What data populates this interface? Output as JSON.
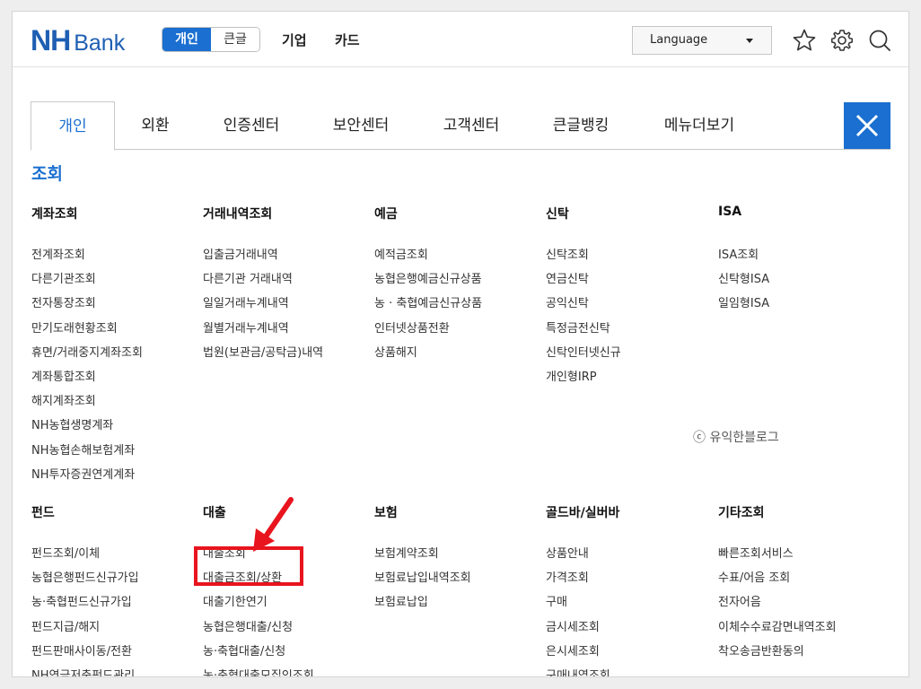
{
  "header": {
    "logo_nh": "NH",
    "logo_bank": "Bank",
    "mode_personal": "개인",
    "mode_large": "큰글",
    "link_business": "기업",
    "link_card": "카드",
    "language_label": "Language"
  },
  "tabs": [
    "개인",
    "외환",
    "인증센터",
    "보안센터",
    "고객센터",
    "큰글뱅킹",
    "메뉴더보기"
  ],
  "section_title": "조회",
  "columns_top": [
    {
      "title": "계좌조회",
      "items": [
        "전계좌조회",
        "다른기관조회",
        "전자통장조회",
        "만기도래현황조회",
        "휴면/거래중지계좌조회",
        "계좌통합조회",
        "해지계좌조회",
        "NH농협생명계좌",
        "NH농협손해보험계좌",
        "NH투자증권연계계좌"
      ]
    },
    {
      "title": "거래내역조회",
      "items": [
        "입출금거래내역",
        "다른기관 거래내역",
        "일일거래누계내역",
        "월별거래누계내역",
        "법원(보관금/공탁금)내역"
      ]
    },
    {
      "title": "예금",
      "items": [
        "예적금조회",
        "농협은행예금신규상품",
        "농 · 축협예금신규상품",
        "인터넷상품전환",
        "상품해지"
      ]
    },
    {
      "title": "신탁",
      "items": [
        "신탁조회",
        "연금신탁",
        "공익신탁",
        "특정금전신탁",
        "신탁인터넷신규",
        "개인형IRP"
      ]
    },
    {
      "title": "ISA",
      "items": [
        "ISA조회",
        "신탁형ISA",
        "일임형ISA"
      ]
    }
  ],
  "columns_bottom": [
    {
      "title": "펀드",
      "items": [
        "펀드조회/이체",
        "농협은행펀드신규가입",
        "농·축협펀드신규가입",
        "펀드지급/해지",
        "펀드판매사이동/전환",
        "NH연금저축펀드관리"
      ]
    },
    {
      "title": "대출",
      "items": [
        "대출조회",
        "대출금조회/상환",
        "대출기한연기",
        "농협은행대출/신청",
        "농·축협대출/신청",
        "농·축협대출모집인조회"
      ]
    },
    {
      "title": "보험",
      "items": [
        "보험계약조회",
        "보험료납입내역조회",
        "보험료납입"
      ]
    },
    {
      "title": "골드바/실버바",
      "items": [
        "상품안내",
        "가격조회",
        "구매",
        "금시세조회",
        "은시세조회",
        "구매내역조회"
      ]
    },
    {
      "title": "기타조회",
      "items": [
        "빠른조회서비스",
        "수표/어음 조회",
        "전자어음",
        "이체수수료감면내역조회",
        "착오송금반환동의"
      ]
    }
  ],
  "watermark": "ⓒ 유익한블로그",
  "colors": {
    "brand": "#1a6fd0",
    "highlight": "#e8141e"
  },
  "icons": [
    "star-icon",
    "gear-icon",
    "search-icon",
    "close-icon"
  ]
}
